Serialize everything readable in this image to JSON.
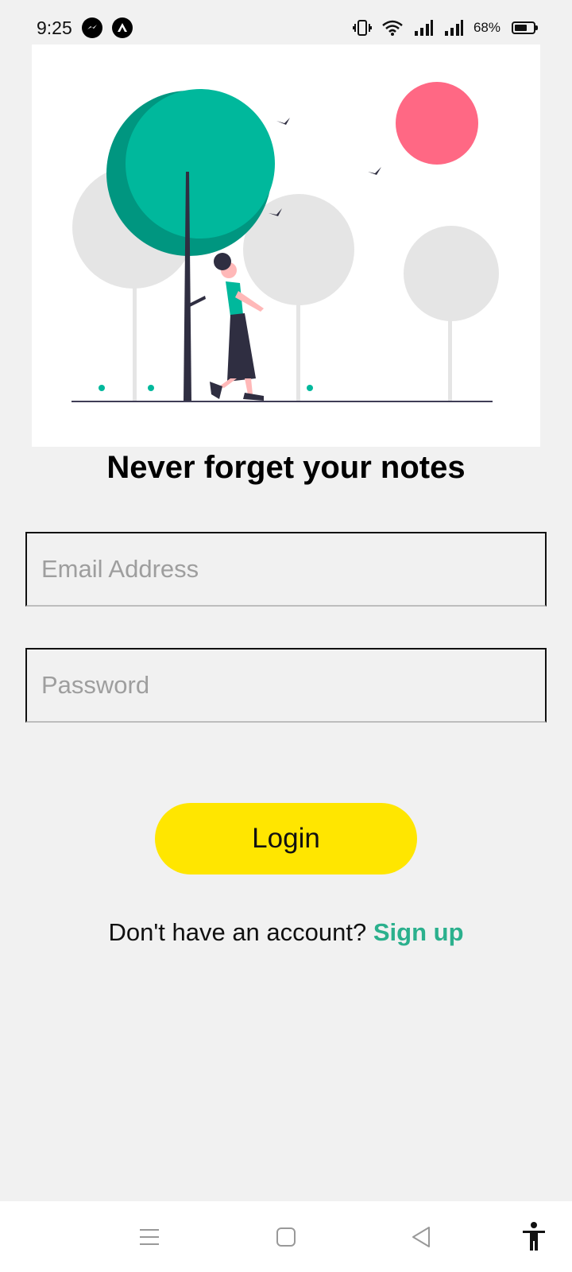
{
  "status_bar": {
    "time": "9:25",
    "battery_percent": "68%",
    "battery_level": 68,
    "icons": [
      "messenger-icon",
      "app-icon",
      "vibrate-icon",
      "wifi-icon",
      "signal-icon",
      "signal-icon-2",
      "battery-icon"
    ]
  },
  "hero": {
    "colors": {
      "teal": "#00b89c",
      "teal_dark": "#009680",
      "red": "#ff6884",
      "gray": "#e5e5e5",
      "ink": "#2f2e41"
    }
  },
  "title": "Never forget your notes",
  "form": {
    "email_placeholder": "Email Address",
    "password_placeholder": "Password",
    "email_value": "",
    "password_value": ""
  },
  "login_button": {
    "label": "Login",
    "color": "#ffe600"
  },
  "signup": {
    "prompt": "Don't have an account?",
    "link_label": "Sign up",
    "link_color": "#2bb08d"
  },
  "nav_bar": {
    "icons": [
      "menu-icon",
      "home-icon",
      "back-icon",
      "accessibility-icon"
    ]
  }
}
